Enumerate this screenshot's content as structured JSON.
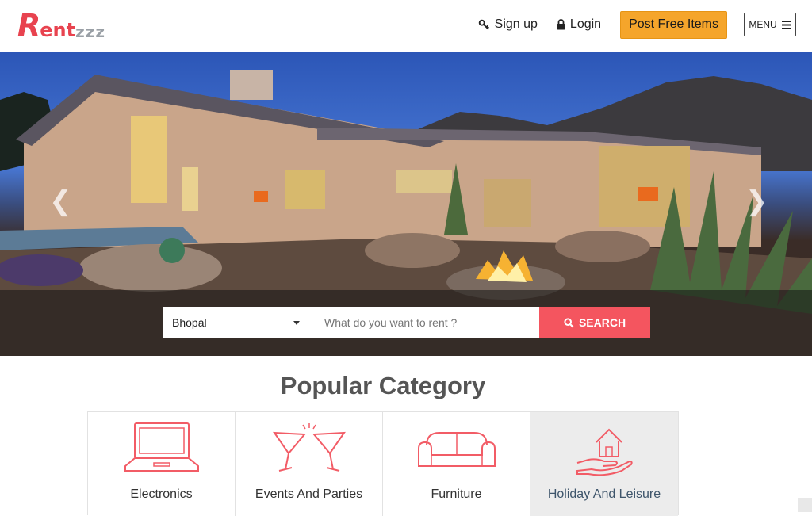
{
  "header": {
    "logo_initial": "R",
    "logo_rest": "ent",
    "logo_suffix": "zzz",
    "signup_label": "Sign up",
    "login_label": "Login",
    "post_label": "Post Free Items",
    "menu_label": "MENU"
  },
  "hero": {
    "prev_glyph": "❮",
    "next_glyph": "❯"
  },
  "search": {
    "city_value": "Bhopal",
    "placeholder": "What do you want to rent ?",
    "button_label": "SEARCH"
  },
  "categories": {
    "title": "Popular Category",
    "items": [
      {
        "label": "Electronics",
        "icon": "laptop-icon"
      },
      {
        "label": "Events And Parties",
        "icon": "cocktail-glasses-icon"
      },
      {
        "label": "Furniture",
        "icon": "sofa-icon"
      },
      {
        "label": "Holiday And Leisure",
        "icon": "hand-house-icon"
      }
    ]
  },
  "colors": {
    "accent": "#f4555f",
    "post_button": "#f5a52b",
    "icon_stroke": "#f25c66"
  }
}
